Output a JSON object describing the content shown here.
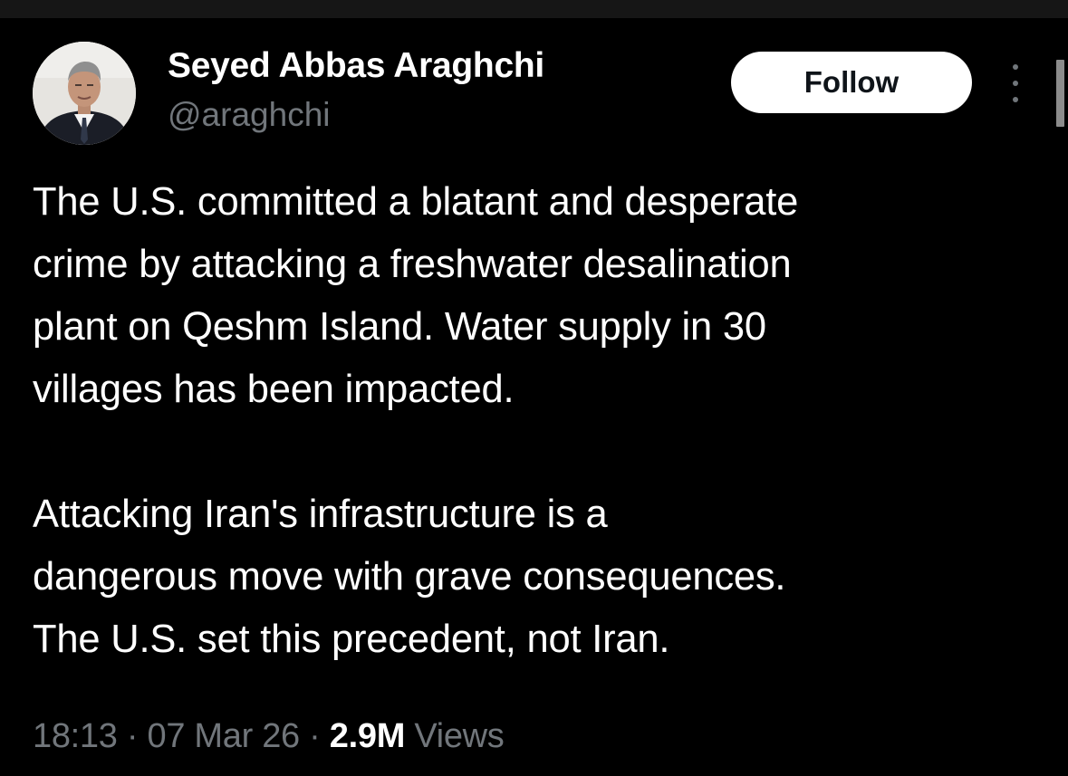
{
  "tweet": {
    "author": {
      "display_name": "Seyed Abbas Araghchi",
      "handle": "@araghchi",
      "avatar_icon": "profile-photo"
    },
    "follow_label": "Follow",
    "more_icon": "more-vertical-icon",
    "text_paragraphs": [
      {
        "lines": [
          "The U.S. committed a blatant and desperate",
          "crime by attacking a freshwater desalination",
          "plant on Qeshm Island. Water supply in 30",
          "villages has been impacted."
        ]
      },
      {
        "lines": [
          "Attacking Iran's infrastructure is a",
          "dangerous move with grave consequences.",
          "The U.S. set this precedent, not Iran."
        ]
      }
    ],
    "meta": {
      "time": "18:13",
      "separator": "·",
      "date": "07 Mar 26",
      "views_count": "2.9M",
      "views_label": "Views"
    }
  },
  "colors": {
    "background": "#000000",
    "text_primary": "#ffffff",
    "text_secondary": "#71767b",
    "button_bg": "#ffffff",
    "button_text": "#0f1419"
  }
}
